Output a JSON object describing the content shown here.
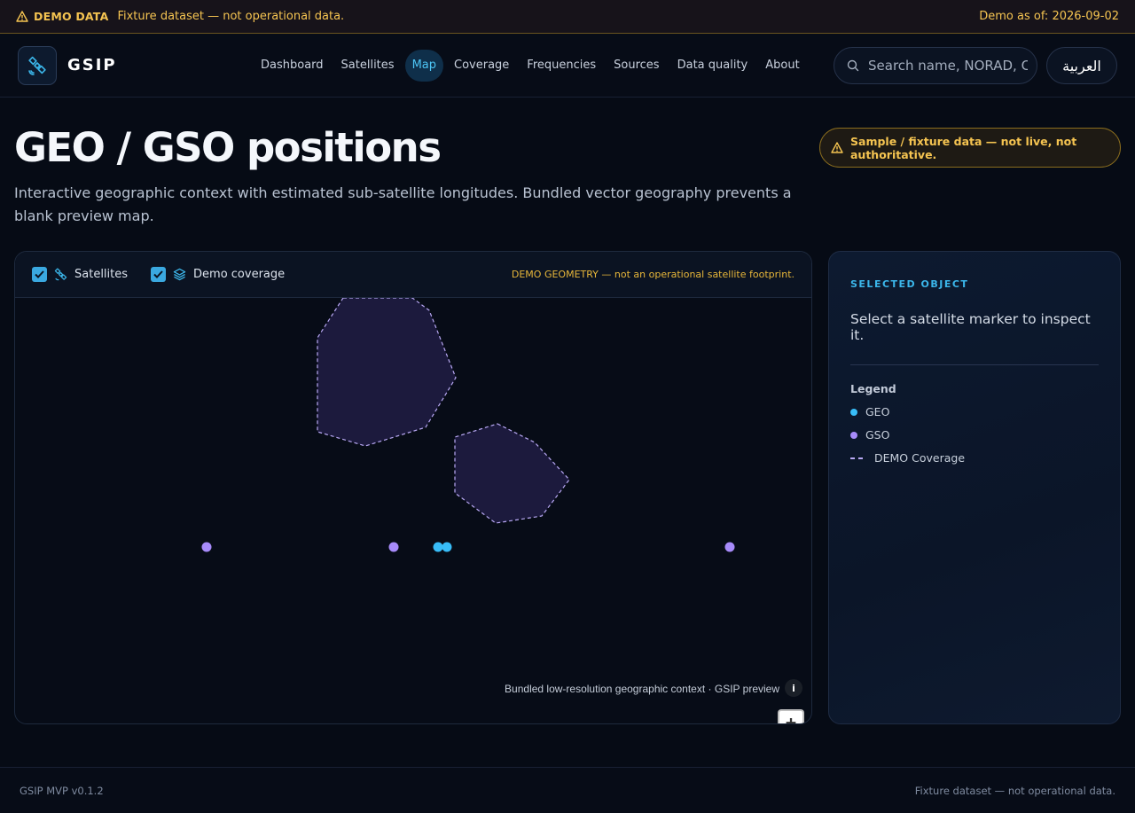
{
  "banner": {
    "label": "DEMO DATA",
    "message": "Fixture dataset — not operational data.",
    "as_of": "Demo as of: 2026-09-02"
  },
  "header": {
    "brand": "GSIP",
    "nav": [
      {
        "label": "Dashboard",
        "active": false
      },
      {
        "label": "Satellites",
        "active": false
      },
      {
        "label": "Map",
        "active": true
      },
      {
        "label": "Coverage",
        "active": false
      },
      {
        "label": "Frequencies",
        "active": false
      },
      {
        "label": "Sources",
        "active": false
      },
      {
        "label": "Data quality",
        "active": false
      },
      {
        "label": "About",
        "active": false
      }
    ],
    "search_placeholder": "Search name, NORAD, COSPAR",
    "language_button": "العربية"
  },
  "page": {
    "title": "GEO / GSO positions",
    "description": "Interactive geographic context with estimated sub-satellite longitudes. Bundled vector geography prevents a blank preview map.",
    "badge": "Sample / fixture data — not live, not authoritative."
  },
  "map": {
    "toggles": {
      "satellites": {
        "label": "Satellites",
        "checked": true
      },
      "coverage": {
        "label": "Demo coverage",
        "checked": true
      }
    },
    "demo_geometry_notice": "DEMO GEOMETRY — not an operational satellite footprint.",
    "attribution": "Bundled low-resolution geographic context · GSIP preview",
    "info_label": "i",
    "zoom_in": "+",
    "zoom_out": "−",
    "colors": {
      "geo": "#38bdf8",
      "gso": "#a78bfa",
      "coverage_fill": "#1c1a3d",
      "coverage_stroke": "#b9a9f5"
    }
  },
  "side": {
    "heading": "SELECTED OBJECT",
    "empty_message": "Select a satellite marker to inspect it.",
    "legend_title": "Legend",
    "legend": {
      "geo": "GEO",
      "gso": "GSO",
      "coverage": "DEMO Coverage"
    }
  },
  "footer": {
    "version": "GSIP MVP v0.1.2",
    "notice": "Fixture dataset — not operational data."
  }
}
